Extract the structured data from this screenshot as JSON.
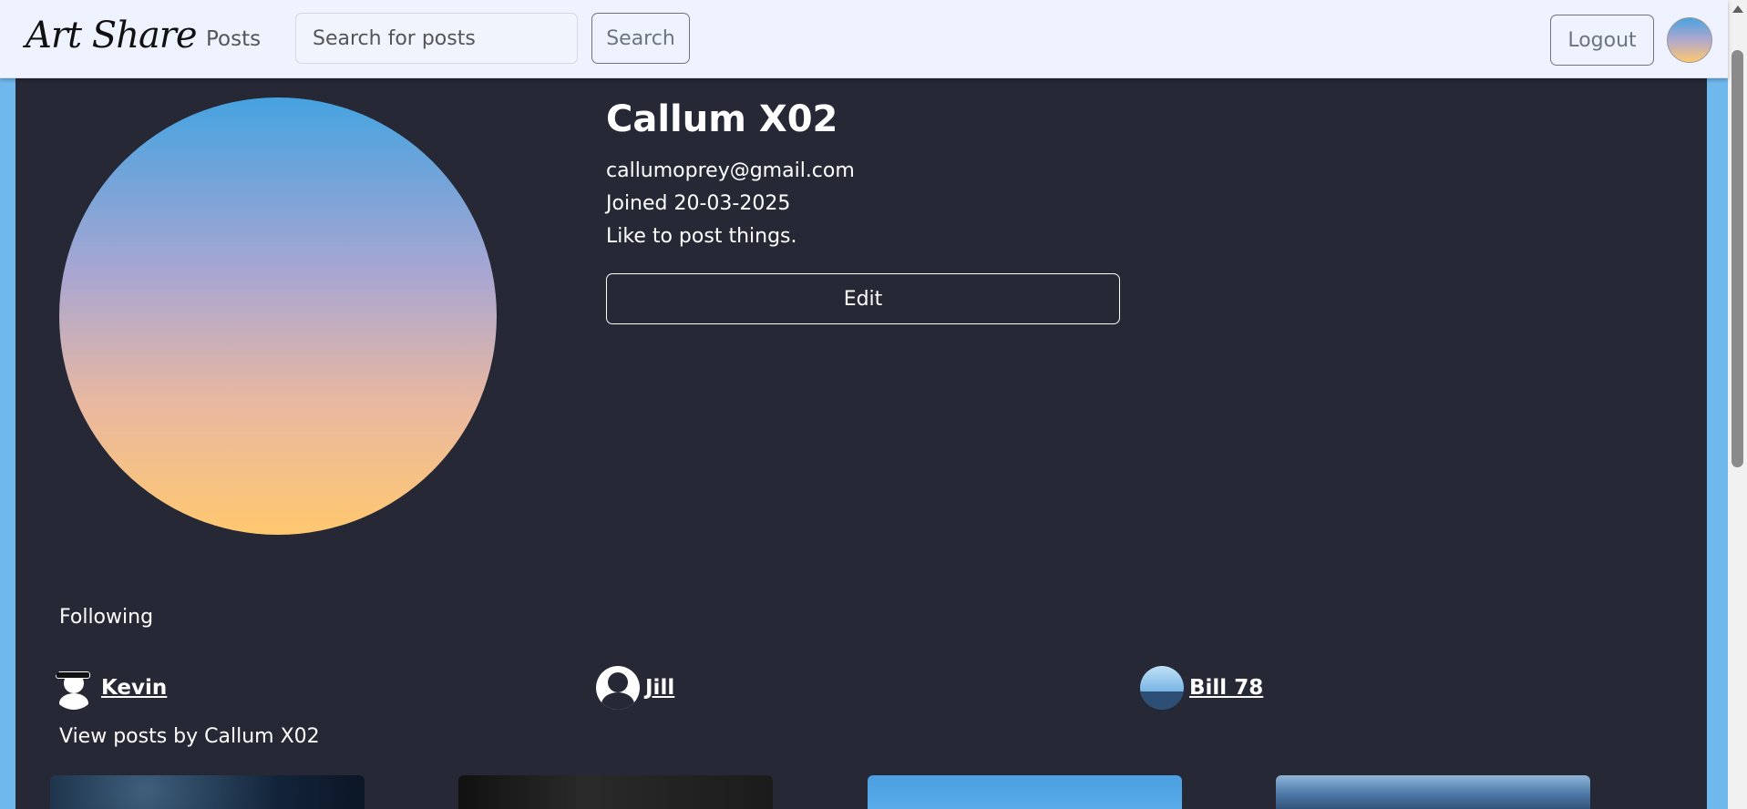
{
  "navbar": {
    "brand": "Art Share",
    "posts_link": "Posts",
    "search_placeholder": "Search for posts",
    "search_button": "Search",
    "logout_button": "Logout"
  },
  "profile": {
    "name": "Callum X02",
    "email": "callumoprey@gmail.com",
    "joined": "Joined 20-03-2025",
    "bio": "Like to post things.",
    "edit_button": "Edit"
  },
  "following": {
    "label": "Following",
    "users": [
      {
        "name": "Kevin",
        "avatar": "avatar-hat-icon"
      },
      {
        "name": "Jill",
        "avatar": "default-user-icon"
      },
      {
        "name": "Bill 78",
        "avatar": "landscape-avatar"
      }
    ]
  },
  "posts": {
    "label": "View posts by Callum X02",
    "thumbnails": [
      "starry-sky-image",
      "dark-building-image",
      "blue-sky-image",
      "cloudy-sky-image"
    ]
  },
  "colors": {
    "page_bg": "#6fb8ee",
    "panel_bg": "#262836",
    "navbar_bg": "#eef3ff",
    "secondary": "#6c757d"
  }
}
